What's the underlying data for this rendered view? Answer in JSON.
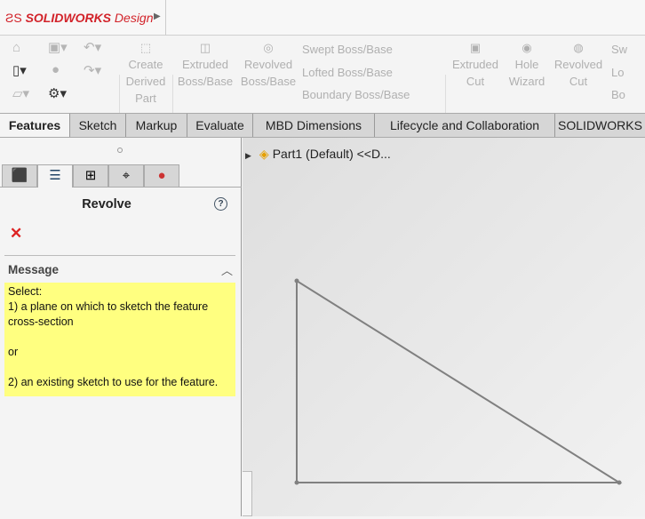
{
  "app": {
    "logo_text": "SOLIDWORKS",
    "logo_suffix": "Design"
  },
  "ribbon": {
    "create_derived_part": "Create Derived Part",
    "extruded_boss": "Extruded Boss/Base",
    "revolved_boss": "Revolved Boss/Base",
    "swept_boss": "Swept Boss/Base",
    "lofted_boss": "Lofted Boss/Base",
    "boundary_boss": "Boundary Boss/Base",
    "extruded_cut": "Extruded Cut",
    "hole_wizard": "Hole Wizard",
    "revolved_cut": "Revolved Cut",
    "swept_cut": "Sw",
    "lofted_cut": "Lo",
    "boundary_cut": "Bo"
  },
  "tabs": [
    "Features",
    "Sketch",
    "Markup",
    "Evaluate",
    "MBD Dimensions",
    "Lifecycle and Collaboration",
    "SOLIDWORKS"
  ],
  "panel": {
    "title": "Revolve",
    "help": "?",
    "cancel": "✕",
    "message_header": "Message",
    "message_lines": [
      "Select:",
      "1) a plane on which to sketch the feature",
      "cross-section",
      "",
      "or",
      "",
      "2) an existing sketch to use for the feature."
    ]
  },
  "tree": {
    "root": "Part1 (Default) <<D..."
  },
  "sketch": {
    "color": "#808080"
  }
}
